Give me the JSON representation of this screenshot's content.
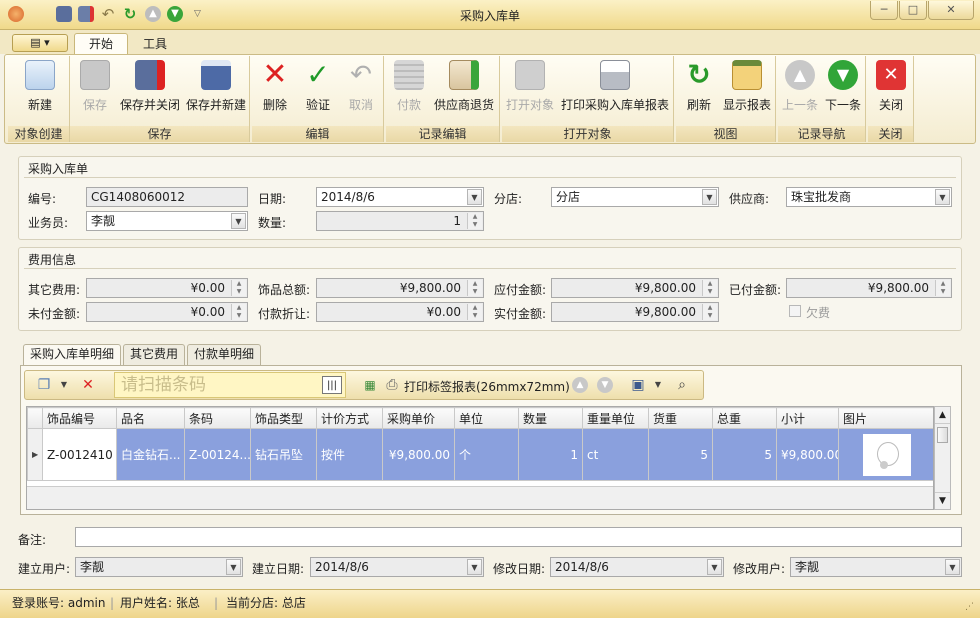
{
  "window": {
    "title": "采购入库单"
  },
  "ribbon": {
    "tabs": [
      "开始",
      "工具"
    ],
    "groups": [
      {
        "label": "对象创建",
        "buttons": [
          {
            "label": "新建",
            "enabled": true,
            "icon": "new-doc-icon"
          }
        ]
      },
      {
        "label": "保存",
        "buttons": [
          {
            "label": "保存",
            "enabled": false,
            "icon": "save-icon"
          },
          {
            "label": "保存并关闭",
            "enabled": true,
            "icon": "save-close-icon"
          },
          {
            "label": "保存并新建",
            "enabled": true,
            "icon": "save-new-icon"
          }
        ]
      },
      {
        "label": "编辑",
        "buttons": [
          {
            "label": "删除",
            "enabled": true,
            "icon": "delete-x-icon"
          },
          {
            "label": "验证",
            "enabled": true,
            "icon": "check-icon"
          },
          {
            "label": "取消",
            "enabled": false,
            "icon": "undo-icon"
          }
        ]
      },
      {
        "label": "记录编辑",
        "buttons": [
          {
            "label": "付款",
            "enabled": false,
            "icon": "coins-icon"
          },
          {
            "label": "供应商退货",
            "enabled": true,
            "icon": "house-add-icon"
          }
        ]
      },
      {
        "label": "打开对象",
        "buttons": [
          {
            "label": "打开对象",
            "enabled": false,
            "icon": "open-object-icon"
          },
          {
            "label": "打印采购入库单报表",
            "enabled": true,
            "icon": "printer-icon"
          }
        ]
      },
      {
        "label": "视图",
        "buttons": [
          {
            "label": "刷新",
            "enabled": true,
            "icon": "refresh-icon"
          },
          {
            "label": "显示报表",
            "enabled": true,
            "icon": "clipboard-report-icon"
          }
        ]
      },
      {
        "label": "记录导航",
        "buttons": [
          {
            "label": "上一条",
            "enabled": false,
            "icon": "arrow-up-icon"
          },
          {
            "label": "下一条",
            "enabled": true,
            "icon": "arrow-down-icon"
          }
        ]
      },
      {
        "label": "关闭",
        "buttons": [
          {
            "label": "关闭",
            "enabled": true,
            "icon": "close-red-icon"
          }
        ]
      }
    ]
  },
  "order": {
    "section": "采购入库单",
    "code_label": "编号:",
    "code": "CG1408060012",
    "date_label": "日期:",
    "date": "2014/8/6",
    "branch_label": "分店:",
    "branch": "分店",
    "supplier_label": "供应商:",
    "supplier": "珠宝批发商",
    "staff_label": "业务员:",
    "staff": "李靓",
    "qty_label": "数量:",
    "qty": "1"
  },
  "fees": {
    "section": "费用信息",
    "other_label": "其它费用:",
    "other": "¥0.00",
    "goods_total_label": "饰品总额:",
    "goods_total": "¥9,800.00",
    "payable_label": "应付金额:",
    "payable": "¥9,800.00",
    "paid_label": "已付金额:",
    "paid": "¥9,800.00",
    "unpaid_label": "未付金额:",
    "unpaid": "¥0.00",
    "discount_label": "付款折让:",
    "discount": "¥0.00",
    "actual_label": "实付金额:",
    "actual": "¥9,800.00",
    "owed_label": "欠费",
    "owed_checked": false
  },
  "detail": {
    "tabs": [
      "采购入库单明细",
      "其它费用",
      "付款单明细"
    ],
    "scan_placeholder": "请扫描条码",
    "print_label": "打印标签报表(26mmx72mm)",
    "columns": [
      "饰品编号",
      "品名",
      "条码",
      "饰品类型",
      "计价方式",
      "采购单价",
      "单位",
      "数量",
      "重量单位",
      "货重",
      "总重",
      "小计",
      "图片"
    ],
    "rows": [
      [
        "Z-0012410",
        "白金钻石...",
        "Z-00124...",
        "钻石吊坠",
        "按件",
        "¥9,800.00",
        "个",
        "1",
        "ct",
        "5",
        "5",
        "¥9,800.00",
        "necklace-image"
      ]
    ]
  },
  "footer": {
    "note_label": "备注:",
    "note": "",
    "creator_label": "建立用户:",
    "creator": "李靓",
    "created_label": "建立日期:",
    "created": "2014/8/6",
    "modified_label": "修改日期:",
    "modified": "2014/8/6",
    "modifier_label": "修改用户:",
    "modifier": "李靓"
  },
  "status": {
    "account": "登录账号: admin",
    "username": "用户姓名: 张总",
    "branch": "当前分店: 总店"
  }
}
